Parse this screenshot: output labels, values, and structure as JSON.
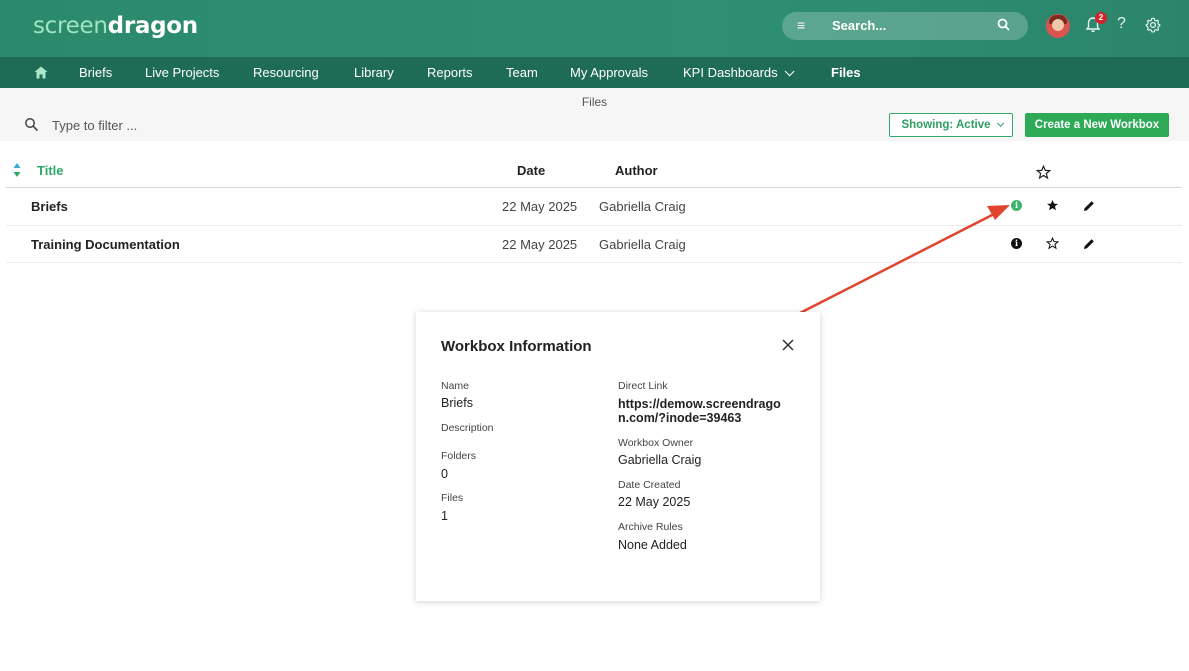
{
  "header": {
    "logo_part1": "screen",
    "logo_part2": "dragon",
    "search_placeholder": "Search...",
    "notification_count": "2",
    "help_label": "?"
  },
  "nav": {
    "items": [
      {
        "label": "Briefs"
      },
      {
        "label": "Live Projects"
      },
      {
        "label": "Resourcing"
      },
      {
        "label": "Library"
      },
      {
        "label": "Reports"
      },
      {
        "label": "Team"
      },
      {
        "label": "My Approvals"
      },
      {
        "label": "KPI Dashboards"
      },
      {
        "label": "Files"
      }
    ]
  },
  "page": {
    "title": "Files",
    "filter_placeholder": "Type to filter ...",
    "showing_label": "Showing: Active",
    "create_label": "Create a New Workbox"
  },
  "table": {
    "columns": {
      "title": "Title",
      "date": "Date",
      "author": "Author"
    },
    "rows": [
      {
        "title": "Briefs",
        "date": "22 May 2025",
        "author": "Gabriella Craig",
        "favorite": true
      },
      {
        "title": "Training Documentation",
        "date": "22 May 2025",
        "author": "Gabriella Craig",
        "favorite": false
      }
    ]
  },
  "modal": {
    "title": "Workbox Information",
    "name_label": "Name",
    "name_value": "Briefs",
    "description_label": "Description",
    "folders_label": "Folders",
    "folders_value": "0",
    "files_label": "Files",
    "files_value": "1",
    "link_label": "Direct Link",
    "link_value_line1": "https://demow.screendrago",
    "link_value_line2": "n.com/?inode=39463",
    "owner_label": "Workbox Owner",
    "owner_value": "Gabriella Craig",
    "created_label": "Date Created",
    "created_value": "22 May 2025",
    "archive_label": "Archive Rules",
    "archive_value": "None Added"
  },
  "colors": {
    "header_bg": "#2d8a6e",
    "nav_bg": "#1f6c56",
    "accent_green": "#2eaa57",
    "annotation_red": "#e0442d"
  }
}
